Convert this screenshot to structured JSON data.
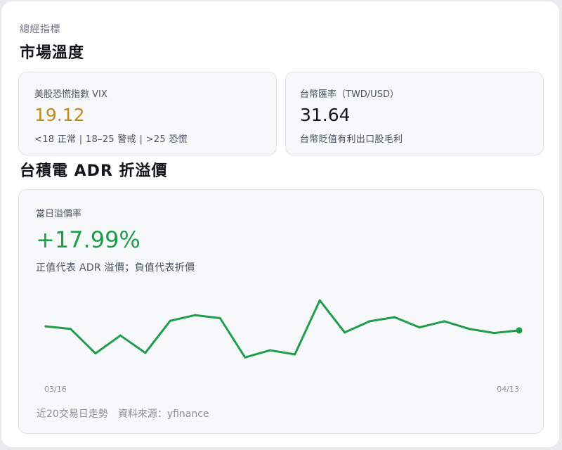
{
  "section": {
    "label": "總經指標",
    "title": "市場溫度"
  },
  "vix": {
    "label": "美股恐慌指數 VIX",
    "value": "19.12",
    "note": "<18 正常 | 18–25 警戒 | >25 恐慌",
    "value_color": "#c08a1e"
  },
  "fx": {
    "label": "台幣匯率（TWD/USD）",
    "value": "31.64",
    "note": "台幣貶值有利出口股毛利"
  },
  "adr": {
    "title": "台積電 ADR 折溢價",
    "card_label": "當日溢價率",
    "value": "+17.99%",
    "value_color": "#1f9d4a",
    "note": "正值代表 ADR 溢價；負值代表折價",
    "footer": "近20交易日走勢　資料來源：yfinance"
  },
  "chart_data": {
    "type": "line",
    "x_start_label": "03/16",
    "x_end_label": "04/13",
    "series": [
      {
        "values": [
          9.5,
          9.0,
          4.2,
          7.7,
          4.3,
          10.6,
          11.7,
          11.1,
          3.4,
          4.8,
          4.0,
          14.6,
          8.3,
          10.5,
          11.3,
          9.3,
          10.5,
          9.0,
          8.2,
          8.7
        ]
      }
    ],
    "ylim": [
      0,
      16
    ],
    "line_color": "#1f9d4a",
    "grid": false
  }
}
